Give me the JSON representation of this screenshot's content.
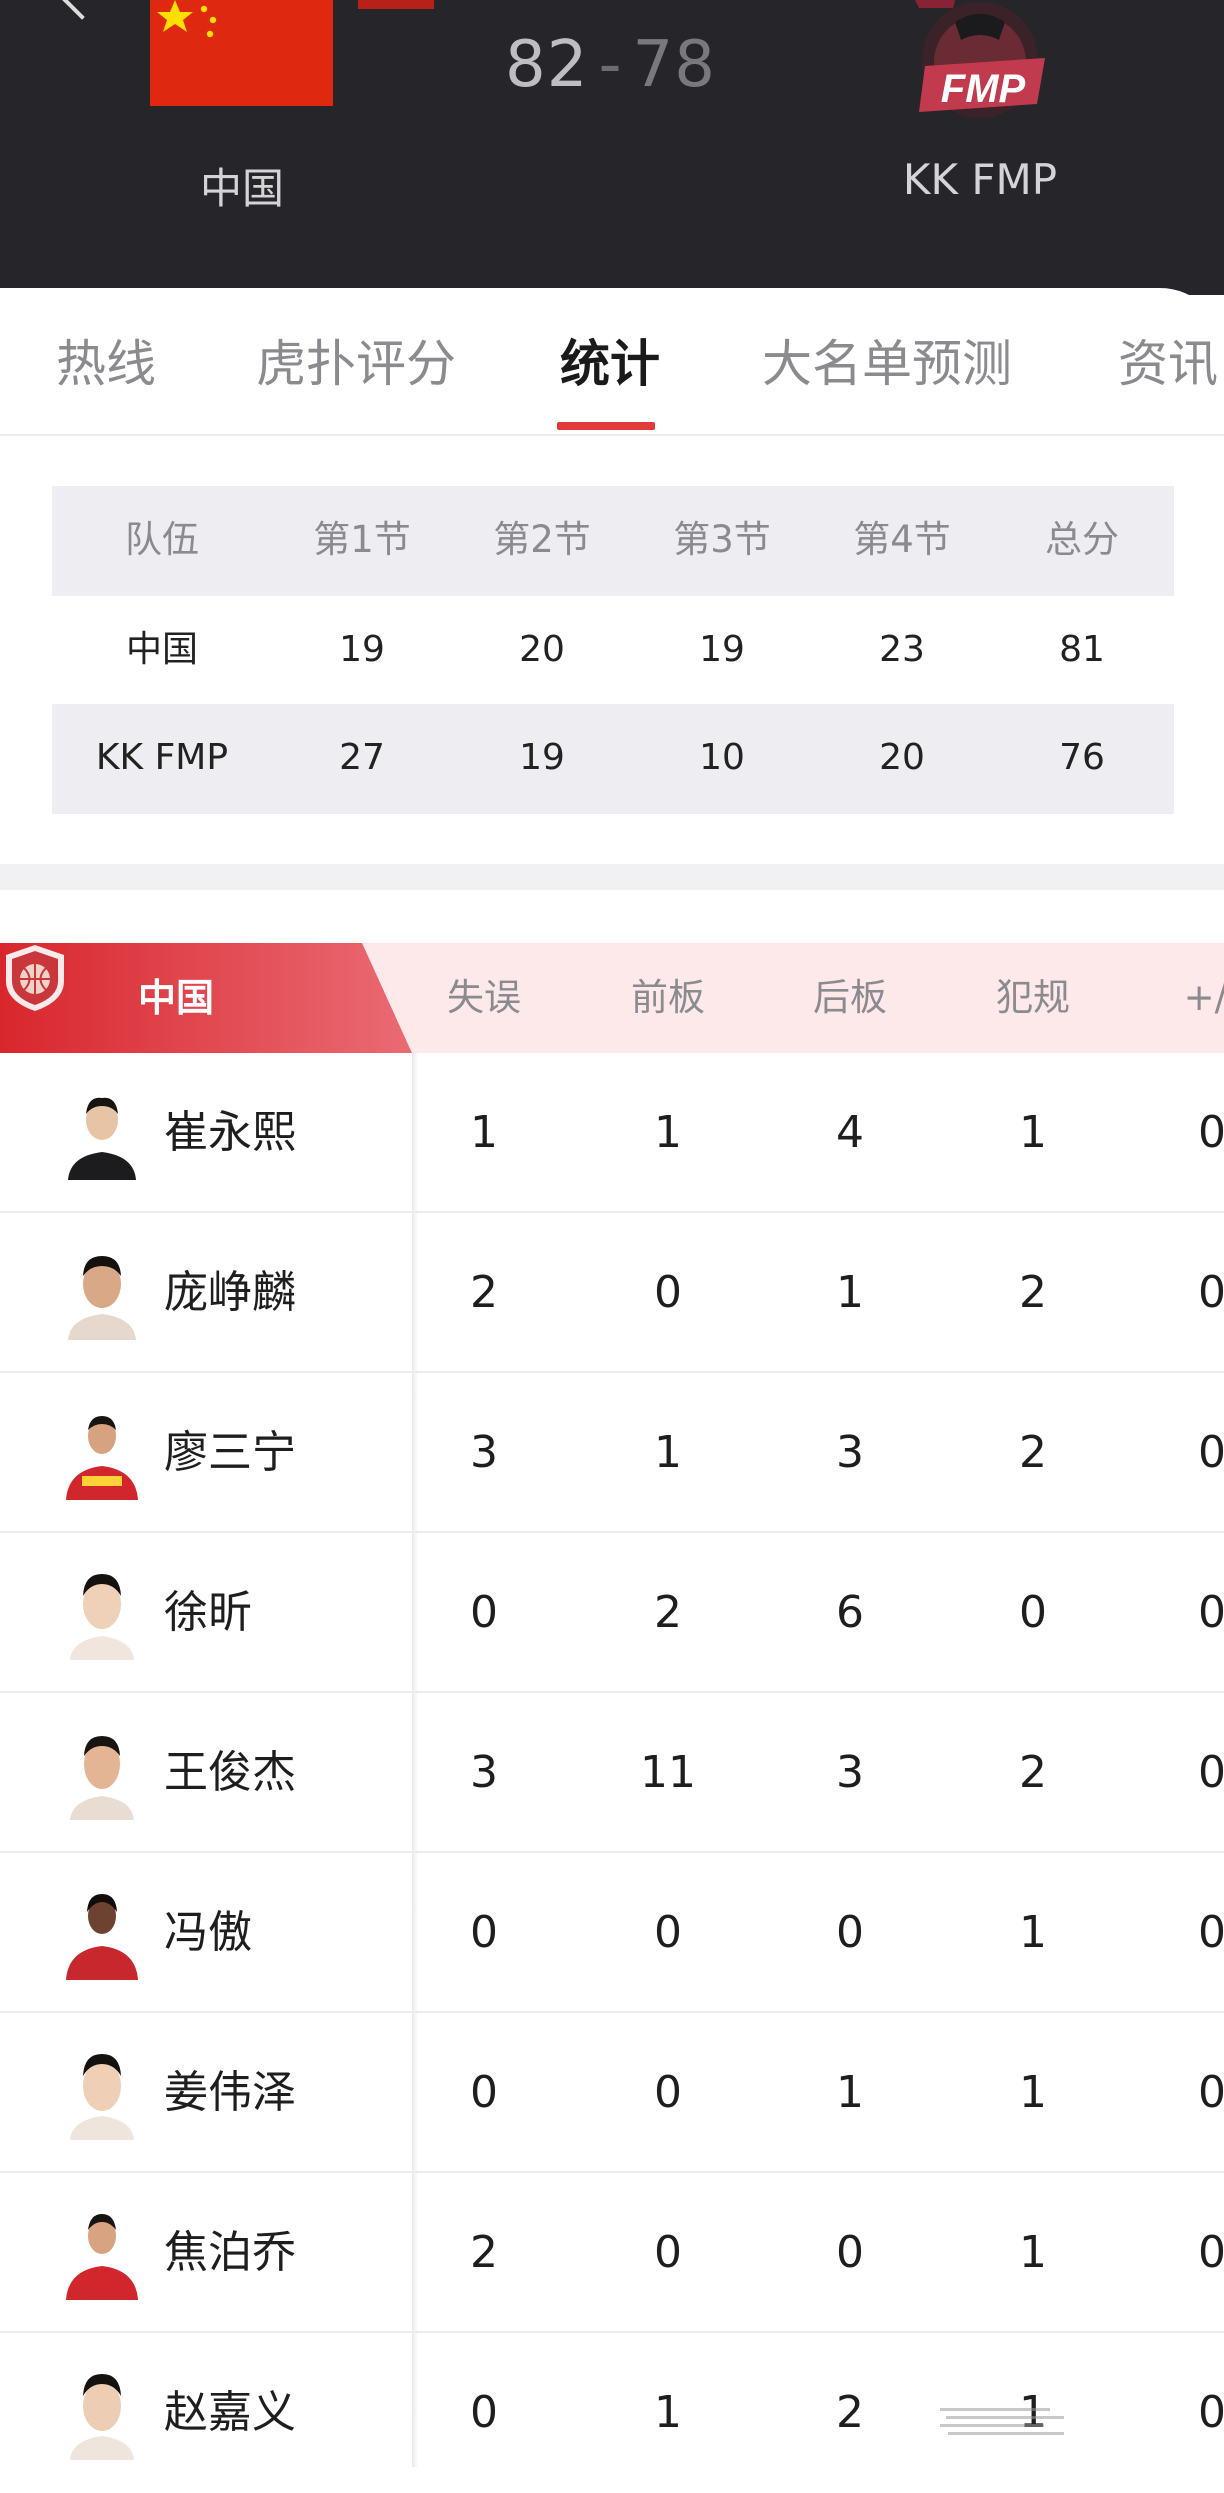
{
  "header": {
    "home_team": "中国",
    "away_team": "KK FMP",
    "score_home": "82",
    "score_separator": "-",
    "score_away": "78",
    "away_logo_text": "FMP"
  },
  "tabs": [
    {
      "label": "热线"
    },
    {
      "label": "虎扑评分"
    },
    {
      "label": "统计"
    },
    {
      "label": "大名单预测"
    },
    {
      "label": "资讯"
    }
  ],
  "active_tab": "统计",
  "quarter_table": {
    "headers": [
      "队伍",
      "第1节",
      "第2节",
      "第3节",
      "第4节",
      "总分"
    ],
    "rows": [
      [
        "中国",
        "19",
        "20",
        "19",
        "23",
        "81"
      ],
      [
        "KK FMP",
        "27",
        "19",
        "10",
        "20",
        "76"
      ]
    ]
  },
  "player_stats": {
    "team": "中国",
    "columns": [
      "失误",
      "前板",
      "后板",
      "犯规",
      "+/-"
    ],
    "players": [
      {
        "name": "崔永熙",
        "values": [
          "1",
          "1",
          "4",
          "1",
          "0"
        ]
      },
      {
        "name": "庞峥麟",
        "values": [
          "2",
          "0",
          "1",
          "2",
          "0"
        ]
      },
      {
        "name": "廖三宁",
        "values": [
          "3",
          "1",
          "3",
          "2",
          "0"
        ]
      },
      {
        "name": "徐昕",
        "values": [
          "0",
          "2",
          "6",
          "0",
          "0"
        ]
      },
      {
        "name": "王俊杰",
        "values": [
          "3",
          "11",
          "3",
          "2",
          "0"
        ]
      },
      {
        "name": "冯傲",
        "values": [
          "0",
          "0",
          "0",
          "1",
          "0"
        ]
      },
      {
        "name": "姜伟泽",
        "values": [
          "0",
          "0",
          "1",
          "1",
          "0"
        ]
      },
      {
        "name": "焦泊乔",
        "values": [
          "2",
          "0",
          "0",
          "1",
          "0"
        ]
      },
      {
        "name": "赵嘉义",
        "values": [
          "0",
          "1",
          "2",
          "1",
          "0"
        ]
      }
    ]
  },
  "colors": {
    "header_bg": "#25252a",
    "accent_red": "#e23a3a",
    "team_banner_red": "#e0393c",
    "stats_header_pink": "#fde8ea"
  }
}
